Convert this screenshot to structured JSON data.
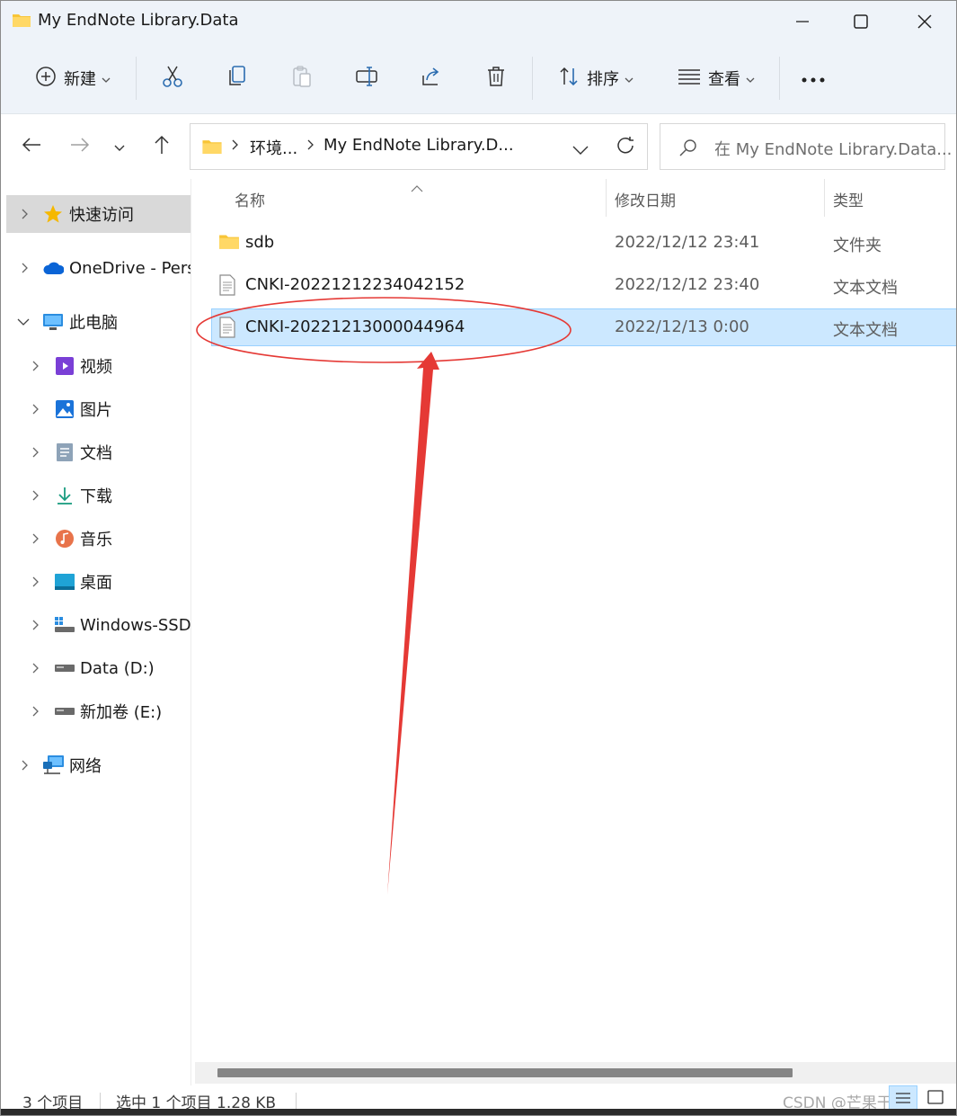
{
  "window": {
    "title": "My EndNote Library.Data",
    "colors": {
      "chrome": "#eef3f9",
      "selection": "#cce8ff",
      "selection_border": "#99d1ff",
      "annotation": "#e53935",
      "folder": "#f8c537"
    }
  },
  "toolbar": {
    "new_label": "新建",
    "sort_label": "排序",
    "view_label": "查看",
    "icons": [
      "plus-circle-icon",
      "cut-icon",
      "copy-icon",
      "paste-icon",
      "rename-icon",
      "share-icon",
      "delete-icon",
      "sort-icon",
      "view-icon",
      "more-icon"
    ]
  },
  "address": {
    "crumb1": "环境...",
    "crumb2": "My EndNote Library.D...",
    "search_placeholder": "在 My EndNote Library.Data..."
  },
  "sidebar": {
    "items": [
      {
        "label": "快速访问",
        "icon": "star-icon"
      },
      {
        "label": "OneDrive - Pers",
        "icon": "cloud-icon"
      },
      {
        "label": "此电脑",
        "icon": "monitor-icon"
      },
      {
        "label": "视频",
        "icon": "video-icon"
      },
      {
        "label": "图片",
        "icon": "picture-icon"
      },
      {
        "label": "文档",
        "icon": "document-icon"
      },
      {
        "label": "下载",
        "icon": "download-icon"
      },
      {
        "label": "音乐",
        "icon": "music-icon"
      },
      {
        "label": "桌面",
        "icon": "desktop-icon"
      },
      {
        "label": "Windows-SSD",
        "icon": "drive-icon"
      },
      {
        "label": "Data (D:)",
        "icon": "drive-icon"
      },
      {
        "label": "新加卷 (E:)",
        "icon": "drive-icon"
      },
      {
        "label": "网络",
        "icon": "network-icon"
      }
    ]
  },
  "columns": {
    "name": "名称",
    "date": "修改日期",
    "type": "类型"
  },
  "files": [
    {
      "name": "sdb",
      "date": "2022/12/12 23:41",
      "type": "文件夹",
      "icon": "folder-icon"
    },
    {
      "name": "CNKI-20221212234042152",
      "date": "2022/12/12 23:40",
      "type": "文本文档",
      "icon": "text-file-icon"
    },
    {
      "name": "CNKI-20221213000044964",
      "date": "2022/12/13 0:00",
      "type": "文本文档",
      "icon": "text-file-icon",
      "selected": true
    }
  ],
  "status": {
    "count": "3 个项目",
    "selection": "选中 1 个项目  1.28 KB",
    "watermark": "CSDN @芒果干层"
  }
}
